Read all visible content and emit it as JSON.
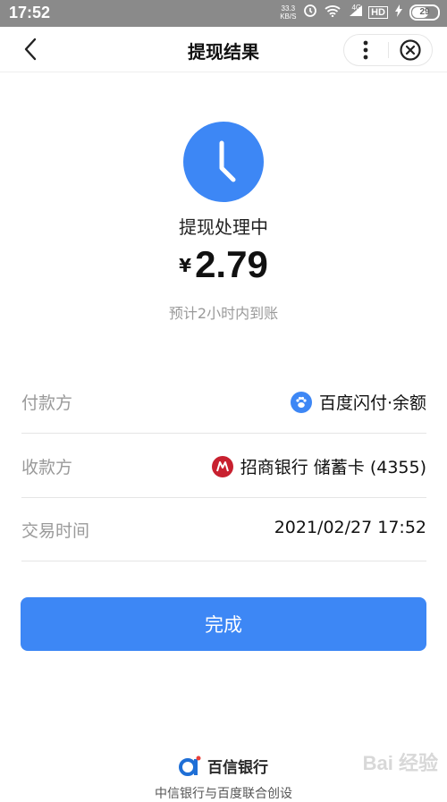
{
  "status_bar": {
    "time": "17:52",
    "speed_value": "33.3",
    "speed_unit": "KB/S",
    "network": "4G",
    "hd": "HD",
    "battery": "29"
  },
  "nav": {
    "title": "提现结果"
  },
  "result": {
    "status": "提现处理中",
    "currency": "¥",
    "amount": "2.79",
    "eta": "预计2小时内到账"
  },
  "details": [
    {
      "label": "付款方",
      "value": "百度闪付·余额",
      "icon": "baidu-paw-icon"
    },
    {
      "label": "收款方",
      "value": "招商银行 储蓄卡 (4355)",
      "icon": "cmb-bank-icon"
    },
    {
      "label": "交易时间",
      "value": "2021/02/27 17:52"
    }
  ],
  "done_button": {
    "label": "完成"
  },
  "footer": {
    "bank_name": "百信银行",
    "text": "中信银行与百度联合创设"
  },
  "watermark": "Bai 经验",
  "colors": {
    "primary": "#3d87f5",
    "cmb_red": "#c8202f",
    "muted": "#9a9a9a"
  }
}
